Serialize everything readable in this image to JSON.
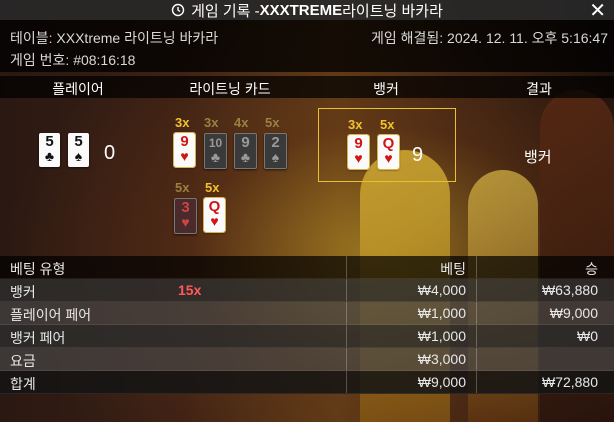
{
  "header": {
    "title_prefix": "게임 기록 - ",
    "title_bold": "XXXTREME",
    "title_suffix": " 라이트닝 바카라"
  },
  "info": {
    "table_label": "테이블: XXXtreme 라이트닝 바카라",
    "game_number": "게임 번호: #08:16:18",
    "resolved": "게임 해결됨: 2024. 12. 11. 오후 5:16:47"
  },
  "columns": {
    "player": "플레이어",
    "lightning_cards": "라이트닝 카드",
    "banker": "뱅커",
    "result": "결과"
  },
  "player": {
    "cards": [
      {
        "rank": "5",
        "suit": "♣"
      },
      {
        "rank": "5",
        "suit": "♠"
      }
    ],
    "score": "0"
  },
  "lightning": {
    "row1": [
      {
        "mult": "3x",
        "rank": "9",
        "suit": "♥",
        "color": "red",
        "dim": false
      },
      {
        "mult": "3x",
        "rank": "10",
        "suit": "♣",
        "color": "black",
        "dim": true
      },
      {
        "mult": "4x",
        "rank": "9",
        "suit": "♣",
        "color": "black",
        "dim": true
      },
      {
        "mult": "5x",
        "rank": "2",
        "suit": "♠",
        "color": "black",
        "dim": true
      }
    ],
    "row2": [
      {
        "mult": "5x",
        "rank": "3",
        "suit": "♥",
        "color": "red",
        "dim": true
      },
      {
        "mult": "5x",
        "rank": "Q",
        "suit": "♥",
        "color": "red",
        "dim": false
      }
    ]
  },
  "banker": {
    "cards": [
      {
        "mult": "3x",
        "rank": "9",
        "suit": "♥"
      },
      {
        "mult": "5x",
        "rank": "Q",
        "suit": "♥"
      }
    ],
    "score": "9"
  },
  "result": "뱅커",
  "bets": {
    "headers": {
      "type": "베팅 유형",
      "bet": "베팅",
      "win": "승"
    },
    "rows": [
      {
        "type": "뱅커",
        "mult": "15x",
        "bet": "₩4,000",
        "win": "₩63,880"
      },
      {
        "type": "플레이어 페어",
        "mult": "",
        "bet": "₩1,000",
        "win": "₩9,000"
      },
      {
        "type": "뱅커 페어",
        "mult": "",
        "bet": "₩1,000",
        "win": "₩0"
      },
      {
        "type": "요금",
        "mult": "",
        "bet": "₩3,000",
        "win": ""
      },
      {
        "type": "합계",
        "mult": "",
        "bet": "₩9,000",
        "win": "₩72,880"
      }
    ]
  }
}
